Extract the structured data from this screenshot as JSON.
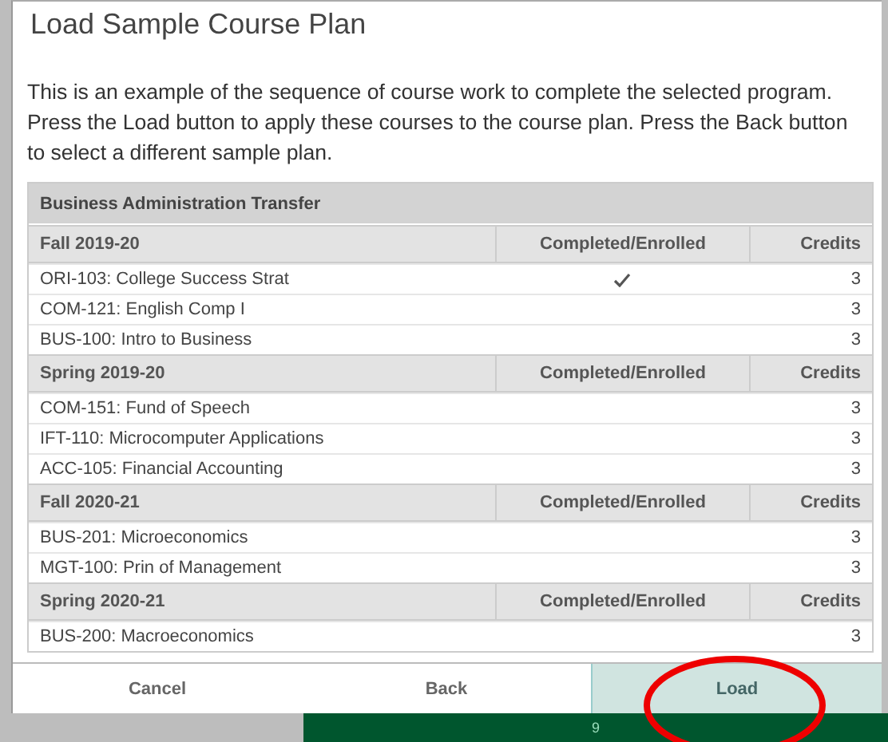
{
  "dialog": {
    "title": "Load Sample Course Plan",
    "description": "This is an example of the sequence of course work to complete the selected program. Press the Load button to apply these courses to the course plan. Press the Back button to select a different sample plan.",
    "table": {
      "program": "Business Administration Transfer",
      "terms": [
        {
          "name": "Fall 2019-20",
          "column_2": "Completed/Enrolled",
          "column_3": "Credits",
          "courses": [
            {
              "name": "ORI-103: College Success Strat",
              "completed": true,
              "credits": "3"
            },
            {
              "name": "COM-121: English Comp I",
              "completed": false,
              "credits": "3"
            },
            {
              "name": "BUS-100: Intro to Business",
              "completed": false,
              "credits": "3"
            }
          ]
        },
        {
          "name": "Spring 2019-20",
          "column_2": "Completed/Enrolled",
          "column_3": "Credits",
          "courses": [
            {
              "name": "COM-151: Fund of Speech",
              "completed": false,
              "credits": "3"
            },
            {
              "name": "IFT-110: Microcomputer Applications",
              "completed": false,
              "credits": "3"
            },
            {
              "name": "ACC-105: Financial Accounting",
              "completed": false,
              "credits": "3"
            }
          ]
        },
        {
          "name": "Fall 2020-21",
          "column_2": "Completed/Enrolled",
          "column_3": "Credits",
          "courses": [
            {
              "name": "BUS-201: Microeconomics",
              "completed": false,
              "credits": "3"
            },
            {
              "name": "MGT-100: Prin of Management",
              "completed": false,
              "credits": "3"
            }
          ]
        },
        {
          "name": "Spring 2020-21",
          "column_2": "Completed/Enrolled",
          "column_3": "Credits",
          "courses": [
            {
              "name": "BUS-200: Macroeconomics",
              "completed": false,
              "credits": "3"
            }
          ]
        }
      ]
    },
    "buttons": [
      {
        "label": "Cancel",
        "kind": "plain"
      },
      {
        "label": "Back",
        "kind": "plain"
      },
      {
        "label": "Load",
        "kind": "primary"
      }
    ]
  },
  "background_bar": {
    "text": "9"
  },
  "annotations": [
    {
      "kind": "ellipse"
    }
  ]
}
